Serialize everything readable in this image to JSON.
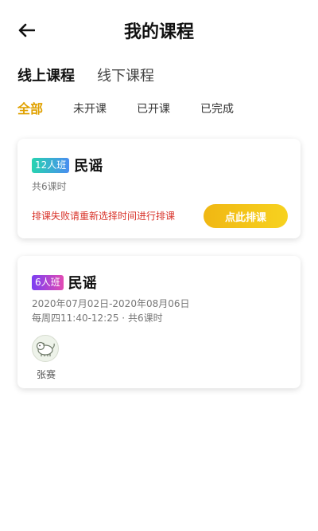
{
  "header": {
    "title": "我的课程",
    "back_icon": "arrow-left-icon"
  },
  "mode_tabs": [
    {
      "label": "线上课程",
      "active": true
    },
    {
      "label": "线下课程",
      "active": false
    }
  ],
  "filter_tabs": [
    {
      "label": "全部",
      "active": true
    },
    {
      "label": "未开课",
      "active": false
    },
    {
      "label": "已开课",
      "active": false
    },
    {
      "label": "已完成",
      "active": false
    }
  ],
  "colors": {
    "accent": "#f3c316",
    "active_filter": "#e0a100",
    "warning": "#d8332a"
  },
  "courses": [
    {
      "badge": "12人班",
      "name": "民谣",
      "lessons": "共6课时",
      "warning": "排课失败请重新选择时间进行排课",
      "action_label": "点此排课"
    },
    {
      "badge": "6人班",
      "name": "民谣",
      "date_range": "2020年07月02日-2020年08月06日",
      "schedule": "每周四11:40-12:25 · 共6课时",
      "teacher_name": "张赛"
    }
  ]
}
